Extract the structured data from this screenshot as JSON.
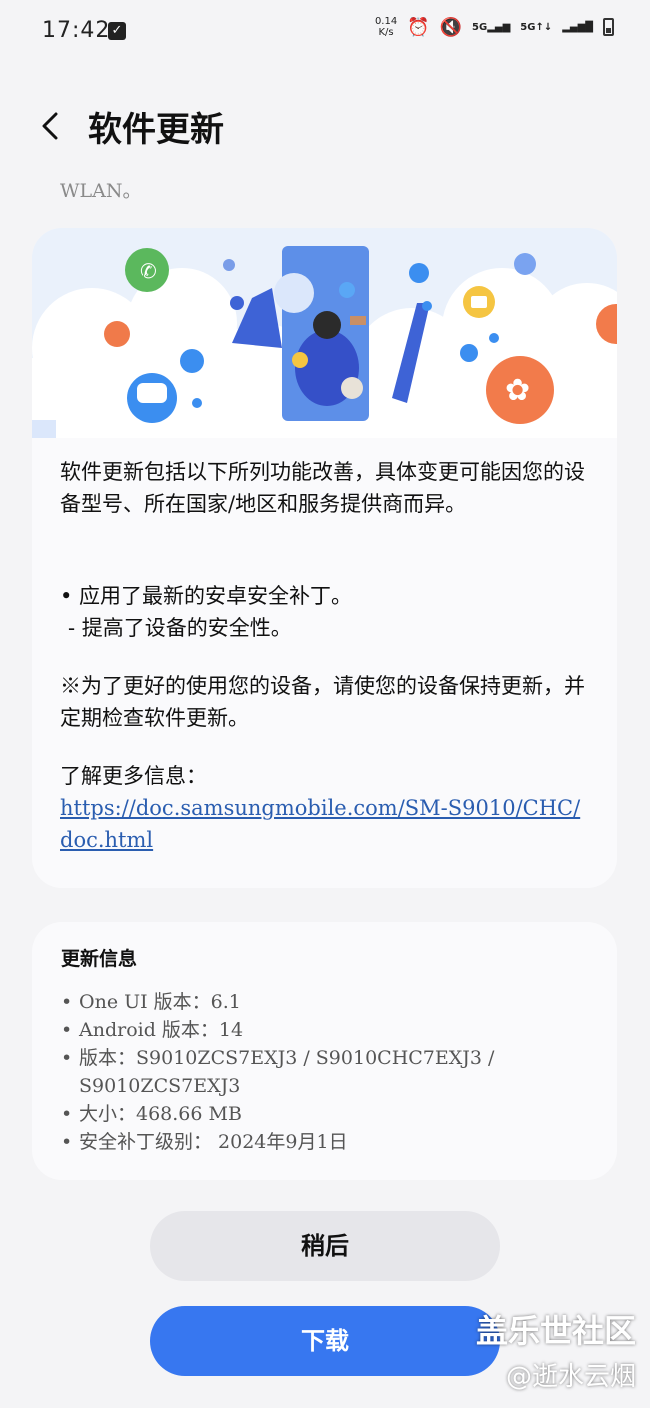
{
  "status_bar": {
    "time": "17:42",
    "net_speed_value": "0.14",
    "net_speed_unit": "K/s",
    "icons": [
      "notification-check-icon",
      "alarm-icon",
      "mute-icon",
      "5g-signal-icon",
      "5g-signal-icon",
      "signal-icon",
      "battery-icon"
    ],
    "network_label_1": "5G",
    "network_label_2": "5G"
  },
  "header": {
    "title": "软件更新"
  },
  "top_text": "WLAN。",
  "main_card": {
    "description": "软件更新包括以下所列功能改善，具体变更可能因您的设备型号、所在国家/地区和服务提供商而异。",
    "bullet_1": "• 应用了最新的安卓安全补丁。",
    "bullet_1_sub": "- 提高了设备的安全性。",
    "note": "※为了更好的使用您的设备，请使您的设备保持更新，并定期检查软件更新。",
    "more_info_label": "了解更多信息：",
    "more_info_link": "https://doc.samsungmobile.com/SM-S9010/CHC/doc.html"
  },
  "info_card": {
    "title": "更新信息",
    "items": [
      "One UI 版本：6.1",
      "Android 版本：14",
      "版本：S9010ZCS7EXJ3 / S9010CHC7EXJ3 / S9010ZCS7EXJ3",
      "大小：468.66 MB",
      "安全补丁级别： 2024年9月1日"
    ]
  },
  "buttons": {
    "later": "稍后",
    "download": "下载"
  },
  "watermark": {
    "line1": "盖乐世社区",
    "line2": "@逝水云烟"
  },
  "colors": {
    "accent": "#3777f0",
    "link": "#2a5db0",
    "background": "#f4f4f6"
  }
}
